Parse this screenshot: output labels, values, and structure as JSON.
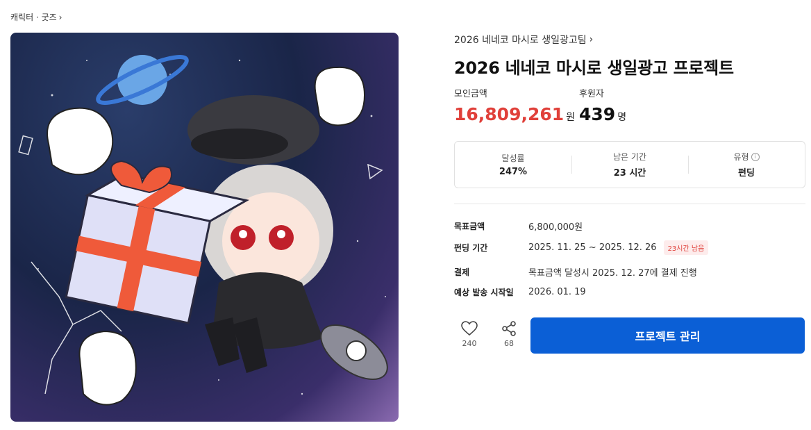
{
  "breadcrumb": {
    "label": "캐릭터 · 굿즈",
    "chevron": "›"
  },
  "project": {
    "creator": "2026 네네코 마시로 생일광고팀",
    "title": "2026 네네코 마시로 생일광고 프로젝트"
  },
  "stats": {
    "raised_label": "모인금액",
    "raised_value": "16,809,261",
    "raised_unit": "원",
    "backers_label": "후원자",
    "backers_value": "439",
    "backers_unit": "명"
  },
  "summary": [
    {
      "label": "달성률",
      "value": "247%"
    },
    {
      "label": "남은 기간",
      "value": "23 시간"
    },
    {
      "label": "유형",
      "value": "펀딩",
      "icon": "info-icon"
    }
  ],
  "details": {
    "goal_label": "목표금액",
    "goal_value": "6,800,000원",
    "period_label": "펀딩 기간",
    "period_value": "2025. 11. 25 ~ 2025. 12. 26",
    "period_badge": "23시간 남음",
    "payment_label": "결제",
    "payment_value": "목표금액 달성시 2025. 12. 27에 결제 진행",
    "ship_label": "예상 발송 시작일",
    "ship_value": "2026. 01. 19"
  },
  "actions": {
    "like_count": "240",
    "share_count": "68",
    "manage_label": "프로젝트 관리"
  },
  "colors": {
    "accent": "#0b5fd6",
    "highlight": "#e0403a"
  }
}
